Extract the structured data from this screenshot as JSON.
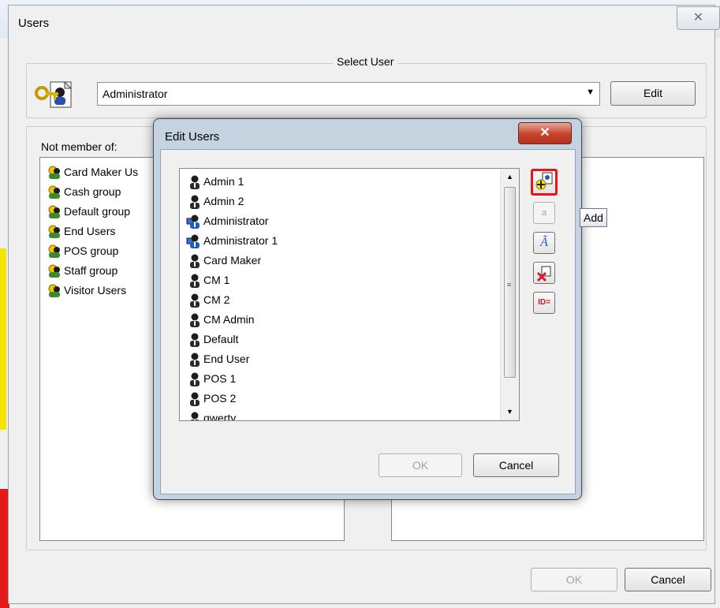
{
  "window": {
    "title": "Users",
    "close_glyph": "✕"
  },
  "select_user": {
    "legend": "Select User",
    "combo_value": "Administrator",
    "edit_label": "Edit"
  },
  "not_member": {
    "label": "Not member of:",
    "groups": [
      "Card Maker Us",
      "Cash group",
      "Default group",
      "End Users",
      "POS group",
      "Staff group",
      "Visitor Users"
    ]
  },
  "edit_dialog": {
    "title": "Edit Users",
    "close_glyph": "✕",
    "users": [
      {
        "name": "Admin 1",
        "type": "user"
      },
      {
        "name": "Admin 2",
        "type": "user"
      },
      {
        "name": "Administrator",
        "type": "admin"
      },
      {
        "name": "Administrator 1",
        "type": "admin"
      },
      {
        "name": "Card Maker",
        "type": "user"
      },
      {
        "name": "CM 1",
        "type": "user"
      },
      {
        "name": "CM 2",
        "type": "user"
      },
      {
        "name": "CM Admin",
        "type": "user"
      },
      {
        "name": "Default",
        "type": "user"
      },
      {
        "name": "End User",
        "type": "user"
      },
      {
        "name": "POS 1",
        "type": "user"
      },
      {
        "name": "POS 2",
        "type": "user"
      },
      {
        "name": "qwerty",
        "type": "user"
      }
    ],
    "tooltip": "Add",
    "id_button_label": "ID=",
    "ok_label": "OK",
    "cancel_label": "Cancel"
  },
  "footer": {
    "ok_label": "OK",
    "cancel_label": "Cancel"
  },
  "colors": {
    "highlight_border": "#e8141c",
    "accent_blue": "#1f5bbf"
  },
  "icons": [
    "users-key-icon",
    "user-icon",
    "admin-user-icon",
    "group-icon",
    "add-user-icon",
    "rename-icon",
    "delete-user-icon",
    "id-icon"
  ]
}
